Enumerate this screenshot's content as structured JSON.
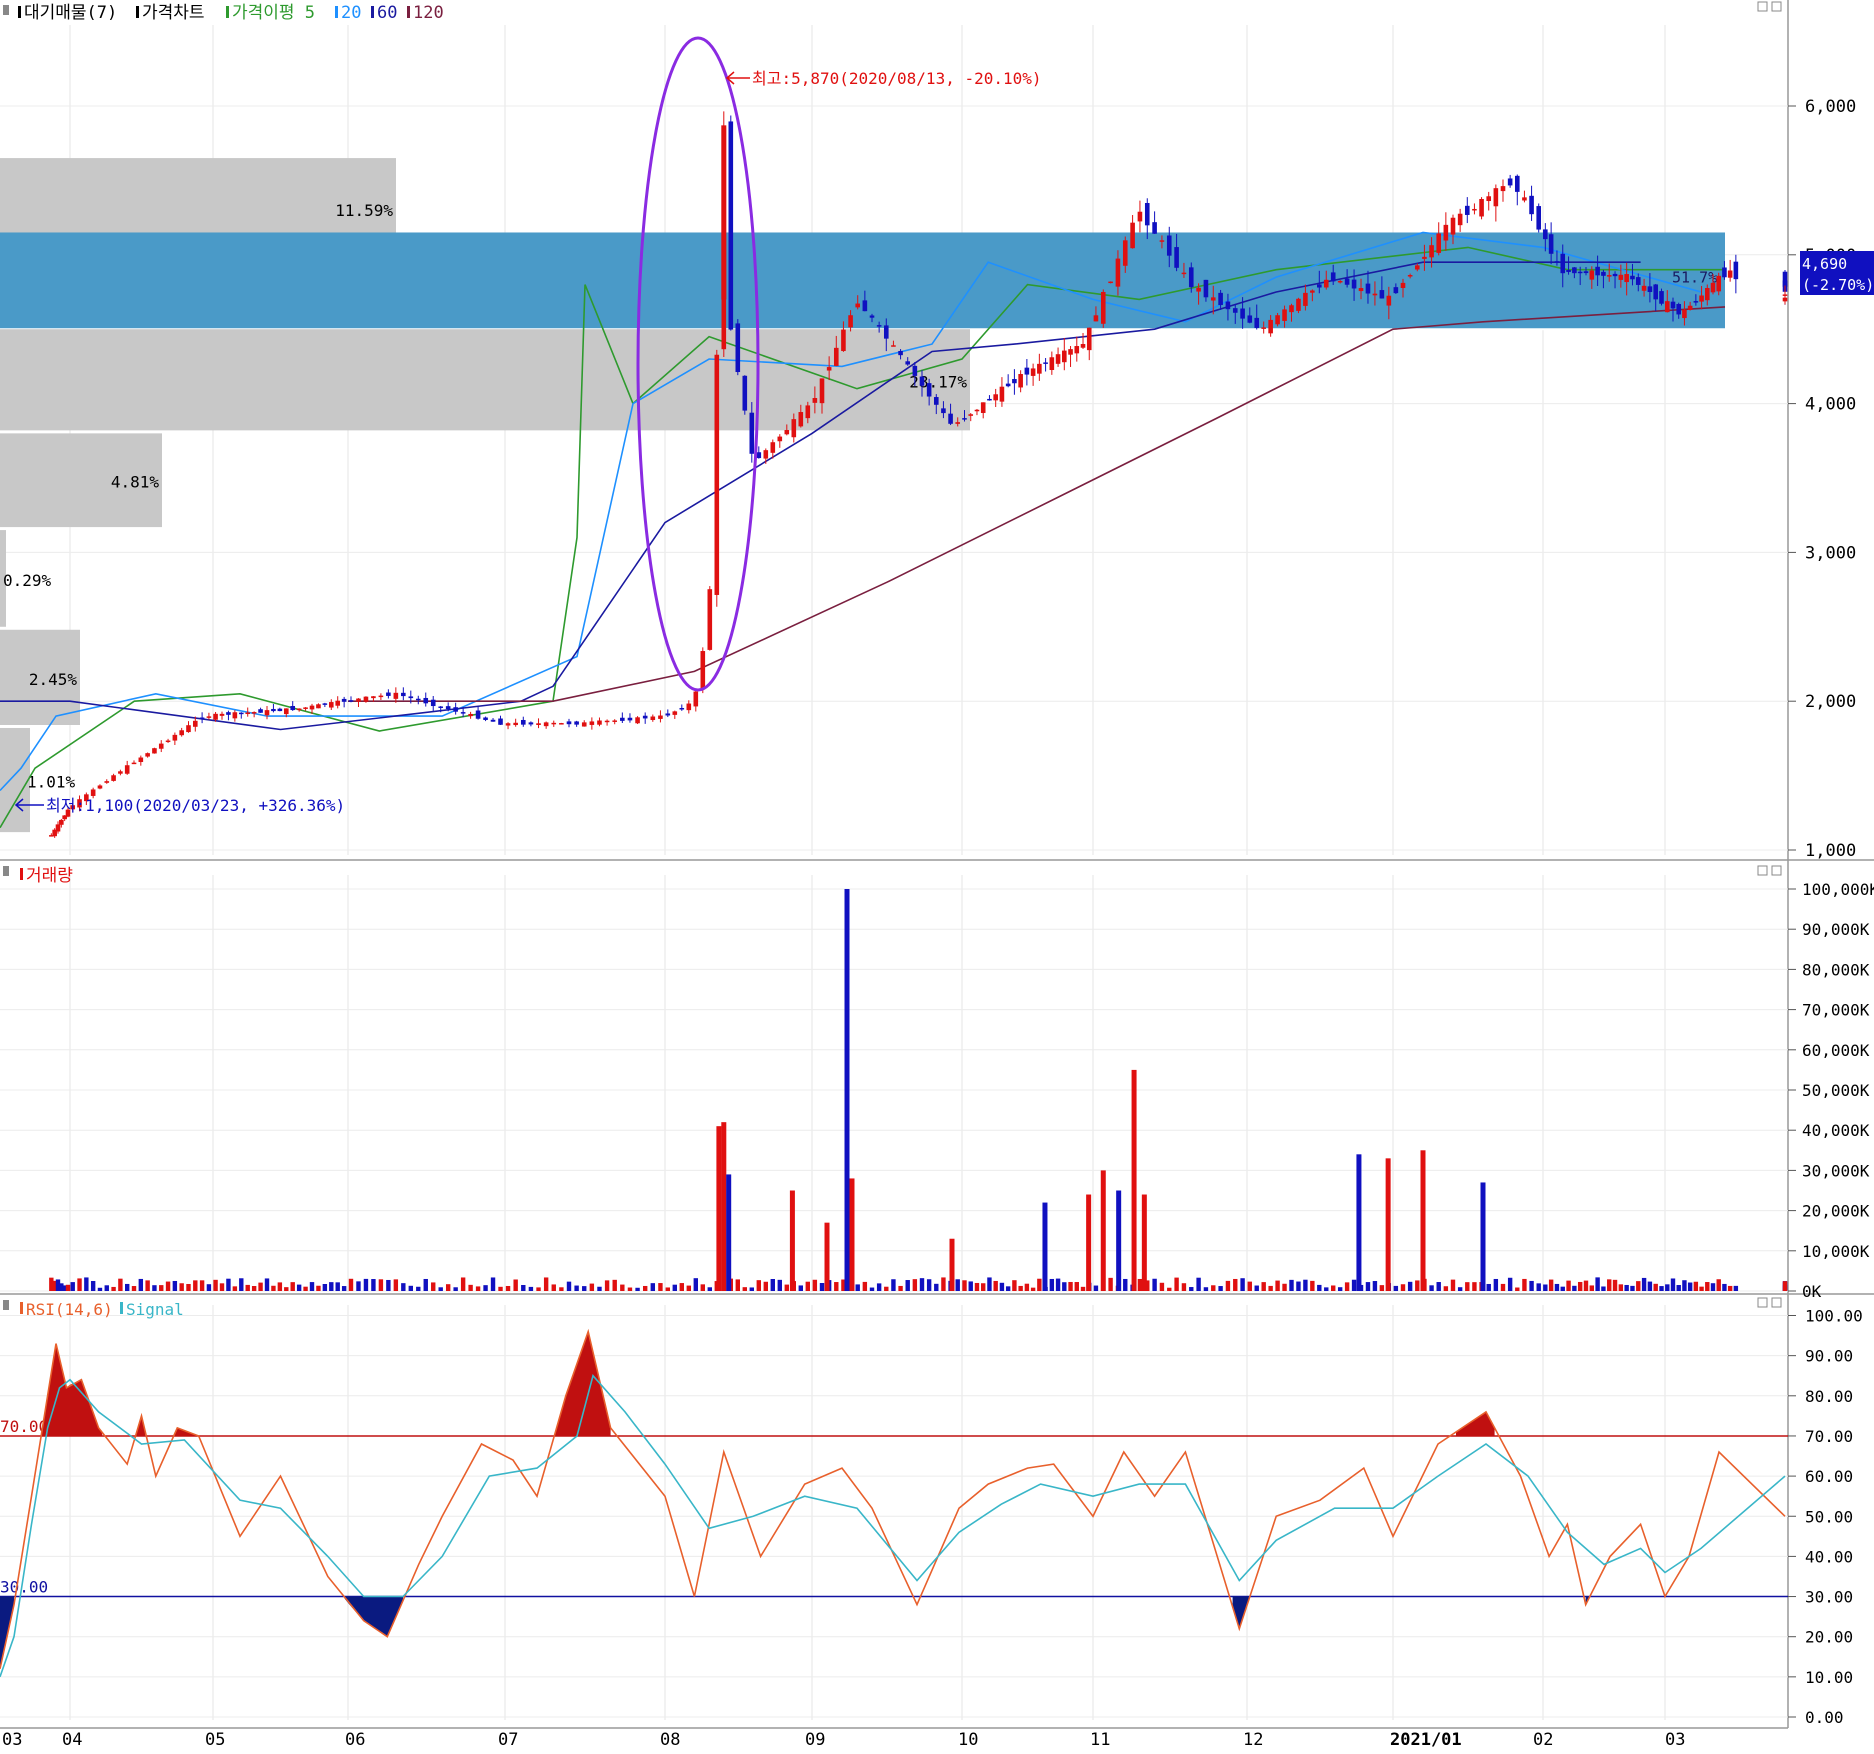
{
  "legend": {
    "items": [
      {
        "label": "대기매물(7)",
        "color": "#000000"
      },
      {
        "label": "가격차트",
        "color": "#000000"
      },
      {
        "label": "가격이평 5",
        "color": "#2e9a2e"
      },
      {
        "label": "20",
        "color": "#1e90ff"
      },
      {
        "label": "60",
        "color": "#1a1aa0"
      },
      {
        "label": "120",
        "color": "#7a1f3f"
      }
    ]
  },
  "volume_title": "거래량",
  "rsi_legend": [
    {
      "label": "RSI(14,6)",
      "color": "#e8602c"
    },
    {
      "label": "Signal",
      "color": "#39b6c8"
    }
  ],
  "price_axis_labels": [
    "6,000",
    "5,000",
    "4,000",
    "3,000",
    "2,000",
    "1,000"
  ],
  "volume_axis_labels": [
    "100,000K",
    "90,000K",
    "80,000K",
    "70,000K",
    "60,000K",
    "50,000K",
    "40,000K",
    "30,000K",
    "20,000K",
    "10,000K",
    "0K"
  ],
  "rsi_axis_labels": [
    "100.00",
    "90.00",
    "80.00",
    "70.00",
    "60.00",
    "50.00",
    "40.00",
    "30.00",
    "20.00",
    "10.00",
    "0.00"
  ],
  "x_labels": [
    "03",
    "04",
    "05",
    "06",
    "07",
    "08",
    "09",
    "10",
    "11",
    "12",
    "2021/01",
    "02",
    "03"
  ],
  "annotations": {
    "high": "최고:5,870(2020/08/13, -20.10%)",
    "low": "최저:1,100(2020/03/23, +326.36%)",
    "last_price": "4,690",
    "last_change": "(-2.70%)",
    "rsi_70": "70.00",
    "rsi_30": "30.00",
    "highlight_pct": "51.7%"
  },
  "colors": {
    "up": "#e01010",
    "down": "#1010c0",
    "ma5": "#2e9a2e",
    "ma20": "#1e90ff",
    "ma60": "#1a1aa0",
    "ma120": "#7a1f3f",
    "volume_profile": "#c8c8c8",
    "highlight_band": "#4a9ac8",
    "oval": "#8a2be2",
    "rsi": "#e8602c",
    "signal": "#39b6c8"
  },
  "chart_data": [
    {
      "type": "candlestick",
      "title": "가격차트",
      "x_range": [
        "2020-03",
        "2021-03"
      ],
      "ylim": [
        1000,
        6200
      ],
      "volume_profile": [
        {
          "price_low": 4950,
          "price_high": 5650,
          "pct": "11.59%"
        },
        {
          "price_low": 4500,
          "price_high": 5150,
          "pct": "51.7%",
          "highlight": true
        },
        {
          "price_low": 3800,
          "price_high": 4500,
          "pct": "28.17%"
        },
        {
          "price_low": 3150,
          "price_high": 3800,
          "pct": "4.81%"
        },
        {
          "price_low": 2480,
          "price_high": 3150,
          "pct": "0.29%"
        },
        {
          "price_low": 1820,
          "price_high": 2480,
          "pct": "2.45%"
        },
        {
          "price_low": 1100,
          "price_high": 1820,
          "pct": "1.01%"
        }
      ],
      "close_points": [
        {
          "date": "2020-03-23",
          "close": 1100
        },
        {
          "date": "2020-04-10",
          "close": 1500
        },
        {
          "date": "2020-04-29",
          "close": 1900
        },
        {
          "date": "2020-05-20",
          "close": 1950
        },
        {
          "date": "2020-06-10",
          "close": 2050
        },
        {
          "date": "2020-06-30",
          "close": 1850
        },
        {
          "date": "2020-07-15",
          "close": 1850
        },
        {
          "date": "2020-07-31",
          "close": 1900
        },
        {
          "date": "2020-08-07",
          "close": 2000
        },
        {
          "date": "2020-08-10",
          "close": 2600
        },
        {
          "date": "2020-08-13",
          "close": 5870
        },
        {
          "date": "2020-08-14",
          "close": 4600
        },
        {
          "date": "2020-08-19",
          "close": 3600
        },
        {
          "date": "2020-08-31",
          "close": 4000
        },
        {
          "date": "2020-09-10",
          "close": 4700
        },
        {
          "date": "2020-09-29",
          "close": 3850
        },
        {
          "date": "2020-10-15",
          "close": 4200
        },
        {
          "date": "2020-10-29",
          "close": 4400
        },
        {
          "date": "2020-11-10",
          "close": 5300
        },
        {
          "date": "2020-11-20",
          "close": 4800
        },
        {
          "date": "2020-12-04",
          "close": 4500
        },
        {
          "date": "2020-12-18",
          "close": 4850
        },
        {
          "date": "2020-12-30",
          "close": 4700
        },
        {
          "date": "2021-01-12",
          "close": 5200
        },
        {
          "date": "2021-01-25",
          "close": 5500
        },
        {
          "date": "2021-02-05",
          "close": 4900
        },
        {
          "date": "2021-02-22",
          "close": 4850
        },
        {
          "date": "2021-03-05",
          "close": 4600
        },
        {
          "date": "2021-03-17",
          "close": 4900
        },
        {
          "date": "2021-03-26",
          "close": 4690
        }
      ],
      "moving_averages": {
        "ma5": [
          [
            0,
            1150
          ],
          [
            0.5,
            1550
          ],
          [
            1.45,
            2000
          ],
          [
            2.2,
            2050
          ],
          [
            3.2,
            1800
          ],
          [
            4.3,
            2000
          ],
          [
            4.45,
            3100
          ],
          [
            4.5,
            4800
          ],
          [
            4.8,
            4000
          ],
          [
            5.3,
            4450
          ],
          [
            6.3,
            4100
          ],
          [
            7.0,
            4300
          ],
          [
            7.5,
            4800
          ],
          [
            8.3,
            4700
          ],
          [
            9.2,
            4900
          ],
          [
            10.5,
            5050
          ],
          [
            11.2,
            4900
          ],
          [
            12.5,
            4900
          ]
        ],
        "ma20": [
          [
            0,
            1400
          ],
          [
            0.3,
            1550
          ],
          [
            0.8,
            1900
          ],
          [
            1.6,
            2050
          ],
          [
            2.4,
            1900
          ],
          [
            3.6,
            1900
          ],
          [
            4.45,
            2300
          ],
          [
            4.8,
            4000
          ],
          [
            5.3,
            4300
          ],
          [
            6.2,
            4250
          ],
          [
            6.8,
            4400
          ],
          [
            7.2,
            4950
          ],
          [
            8.0,
            4700
          ],
          [
            8.6,
            4550
          ],
          [
            9.2,
            4850
          ],
          [
            10.2,
            5150
          ],
          [
            11.0,
            5050
          ],
          [
            12.3,
            4750
          ]
        ],
        "ma60": [
          [
            0,
            2000
          ],
          [
            1.0,
            2000
          ],
          [
            2.5,
            1810
          ],
          [
            3.3,
            1900
          ],
          [
            4.1,
            2000
          ],
          [
            4.3,
            2100
          ],
          [
            5.0,
            3200
          ],
          [
            6.0,
            3800
          ],
          [
            6.8,
            4350
          ],
          [
            7.4,
            4400
          ],
          [
            8.4,
            4500
          ],
          [
            9.2,
            4750
          ],
          [
            10.2,
            4950
          ],
          [
            11.8,
            4950
          ]
        ],
        "ma120": [
          [
            3.0,
            2000
          ],
          [
            4.3,
            2000
          ],
          [
            5.2,
            2200
          ],
          [
            6.5,
            2800
          ],
          [
            7.8,
            3400
          ],
          [
            8.8,
            3900
          ],
          [
            10.0,
            4500
          ],
          [
            10.6,
            4550
          ],
          [
            12.5,
            4650
          ]
        ]
      }
    },
    {
      "type": "bar",
      "title": "거래량",
      "unit": "K",
      "ylim": [
        0,
        100000
      ],
      "spikes": [
        {
          "date": "2020-08-12",
          "value": 41000
        },
        {
          "date": "2020-08-13",
          "value": 42000
        },
        {
          "date": "2020-08-14",
          "value": 29000
        },
        {
          "date": "2020-08-27",
          "value": 25000
        },
        {
          "date": "2020-09-04",
          "value": 17000
        },
        {
          "date": "2020-09-08",
          "value": 100000
        },
        {
          "date": "2020-09-09",
          "value": 28000
        },
        {
          "date": "2020-09-29",
          "value": 13000
        },
        {
          "date": "2020-10-20",
          "value": 22000
        },
        {
          "date": "2020-10-30",
          "value": 24000
        },
        {
          "date": "2020-11-03",
          "value": 30000
        },
        {
          "date": "2020-11-06",
          "value": 25000
        },
        {
          "date": "2020-11-09",
          "value": 55000
        },
        {
          "date": "2020-11-11",
          "value": 24000
        },
        {
          "date": "2020-12-24",
          "value": 34000
        },
        {
          "date": "2020-12-30",
          "value": 33000
        },
        {
          "date": "2021-01-07",
          "value": 35000
        },
        {
          "date": "2021-01-19",
          "value": 27000
        }
      ]
    },
    {
      "type": "line",
      "title": "RSI(14,6)",
      "ylim": [
        0,
        100
      ],
      "reference_lines": [
        70,
        30
      ],
      "series": [
        {
          "name": "RSI(14,6)",
          "points": [
            [
              0,
              12
            ],
            [
              0.2,
              28
            ],
            [
              0.45,
              55
            ],
            [
              0.68,
              80
            ],
            [
              0.8,
              93
            ],
            [
              0.95,
              82
            ],
            [
              1.08,
              84
            ],
            [
              1.2,
              72
            ],
            [
              1.4,
              63
            ],
            [
              1.5,
              75
            ],
            [
              1.6,
              60
            ],
            [
              1.75,
              72
            ],
            [
              1.9,
              70
            ],
            [
              2.2,
              45
            ],
            [
              2.5,
              60
            ],
            [
              2.85,
              35
            ],
            [
              3.1,
              24
            ],
            [
              3.25,
              20
            ],
            [
              3.45,
              38
            ],
            [
              3.6,
              50
            ],
            [
              3.85,
              68
            ],
            [
              4.05,
              64
            ],
            [
              4.2,
              55
            ],
            [
              4.38,
              80
            ],
            [
              4.52,
              96
            ],
            [
              4.66,
              72
            ],
            [
              5.0,
              55
            ],
            [
              5.2,
              30
            ],
            [
              5.4,
              66
            ],
            [
              5.65,
              40
            ],
            [
              5.95,
              58
            ],
            [
              6.2,
              62
            ],
            [
              6.4,
              52
            ],
            [
              6.7,
              28
            ],
            [
              6.98,
              52
            ],
            [
              7.2,
              58
            ],
            [
              7.5,
              62
            ],
            [
              7.7,
              63
            ],
            [
              8.0,
              50
            ],
            [
              8.2,
              66
            ],
            [
              8.4,
              55
            ],
            [
              8.6,
              66
            ],
            [
              8.95,
              22
            ],
            [
              9.2,
              50
            ],
            [
              9.5,
              54
            ],
            [
              9.8,
              62
            ],
            [
              10.0,
              45
            ],
            [
              10.3,
              68
            ],
            [
              10.62,
              76
            ],
            [
              10.85,
              60
            ],
            [
              11.05,
              40
            ],
            [
              11.2,
              48
            ],
            [
              11.35,
              28
            ],
            [
              11.55,
              40
            ],
            [
              11.8,
              48
            ],
            [
              12.0,
              30
            ],
            [
              12.2,
              40
            ],
            [
              12.45,
              66
            ],
            [
              12.6,
              50
            ]
          ]
        },
        {
          "name": "Signal",
          "points": [
            [
              0,
              10
            ],
            [
              0.2,
              20
            ],
            [
              0.45,
              48
            ],
            [
              0.68,
              72
            ],
            [
              0.85,
              82
            ],
            [
              1.0,
              84
            ],
            [
              1.2,
              76
            ],
            [
              1.5,
              68
            ],
            [
              1.8,
              69
            ],
            [
              2.2,
              54
            ],
            [
              2.5,
              52
            ],
            [
              2.85,
              40
            ],
            [
              3.1,
              30
            ],
            [
              3.35,
              30
            ],
            [
              3.6,
              40
            ],
            [
              3.9,
              60
            ],
            [
              4.2,
              62
            ],
            [
              4.45,
              70
            ],
            [
              4.55,
              85
            ],
            [
              4.75,
              76
            ],
            [
              5.0,
              63
            ],
            [
              5.3,
              47
            ],
            [
              5.6,
              50
            ],
            [
              5.95,
              55
            ],
            [
              6.3,
              52
            ],
            [
              6.7,
              34
            ],
            [
              6.98,
              46
            ],
            [
              7.3,
              53
            ],
            [
              7.6,
              58
            ],
            [
              8.0,
              55
            ],
            [
              8.3,
              58
            ],
            [
              8.6,
              58
            ],
            [
              8.95,
              34
            ],
            [
              9.2,
              44
            ],
            [
              9.6,
              52
            ],
            [
              10.0,
              52
            ],
            [
              10.3,
              60
            ],
            [
              10.62,
              68
            ],
            [
              10.9,
              60
            ],
            [
              11.2,
              46
            ],
            [
              11.5,
              38
            ],
            [
              11.8,
              42
            ],
            [
              12.0,
              36
            ],
            [
              12.3,
              42
            ],
            [
              12.6,
              60
            ]
          ]
        }
      ]
    }
  ]
}
